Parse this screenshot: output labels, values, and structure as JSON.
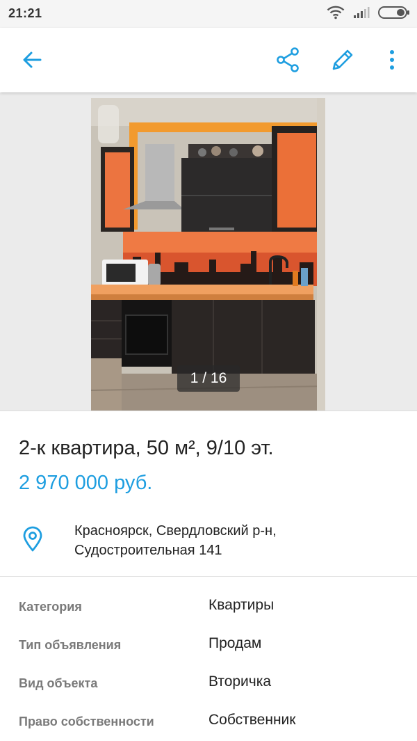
{
  "status_bar": {
    "time": "21:21",
    "icons": [
      "wifi-icon",
      "signal-icon",
      "battery-icon"
    ]
  },
  "app_bar": {
    "icons": [
      "back-arrow-icon",
      "share-icon",
      "edit-pencil-icon",
      "more-vert-icon"
    ],
    "accent_color": "#1e9ee0"
  },
  "gallery": {
    "counter": "1 / 16"
  },
  "listing": {
    "title": "2-к квартира, 50 м², 9/10 эт.",
    "price": "2 970 000 руб.",
    "address_line1": "Красноярск, Свердловский р-н,",
    "address_line2": "Судостроительная 141"
  },
  "details": [
    {
      "key": "Категория",
      "value": "Квартиры"
    },
    {
      "key": "Тип объявления",
      "value": "Продам"
    },
    {
      "key": "Вид объекта",
      "value": "Вторичка"
    },
    {
      "key": "Право собственности",
      "value": "Собственник"
    }
  ]
}
